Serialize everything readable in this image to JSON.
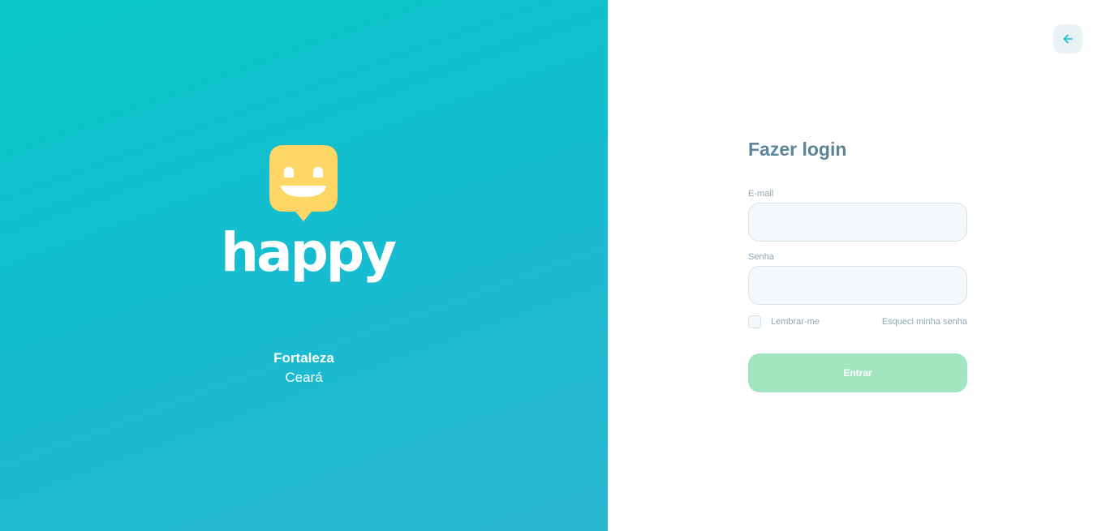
{
  "brand": {
    "name": "happy",
    "logo_icon": "happy-face-balloon-icon",
    "logo_color": "#FFD666"
  },
  "location": {
    "city": "Fortaleza",
    "state": "Ceará"
  },
  "back_button": {
    "icon": "arrow-left-icon"
  },
  "login": {
    "title": "Fazer login",
    "email_label": "E-mail",
    "email_value": "",
    "password_label": "Senha",
    "password_value": "",
    "remember_label": "Lembrar-me",
    "remember_checked": false,
    "forgot_link": "Esqueci minha senha",
    "submit_label": "Entrar"
  },
  "colors": {
    "left_gradient_start": "#09C7CA",
    "left_gradient_end": "#29B6D1",
    "title": "#5C8599",
    "label": "#8FA7B2",
    "submit_bg": "#A1E6C1",
    "accent": "#15C3D6"
  }
}
